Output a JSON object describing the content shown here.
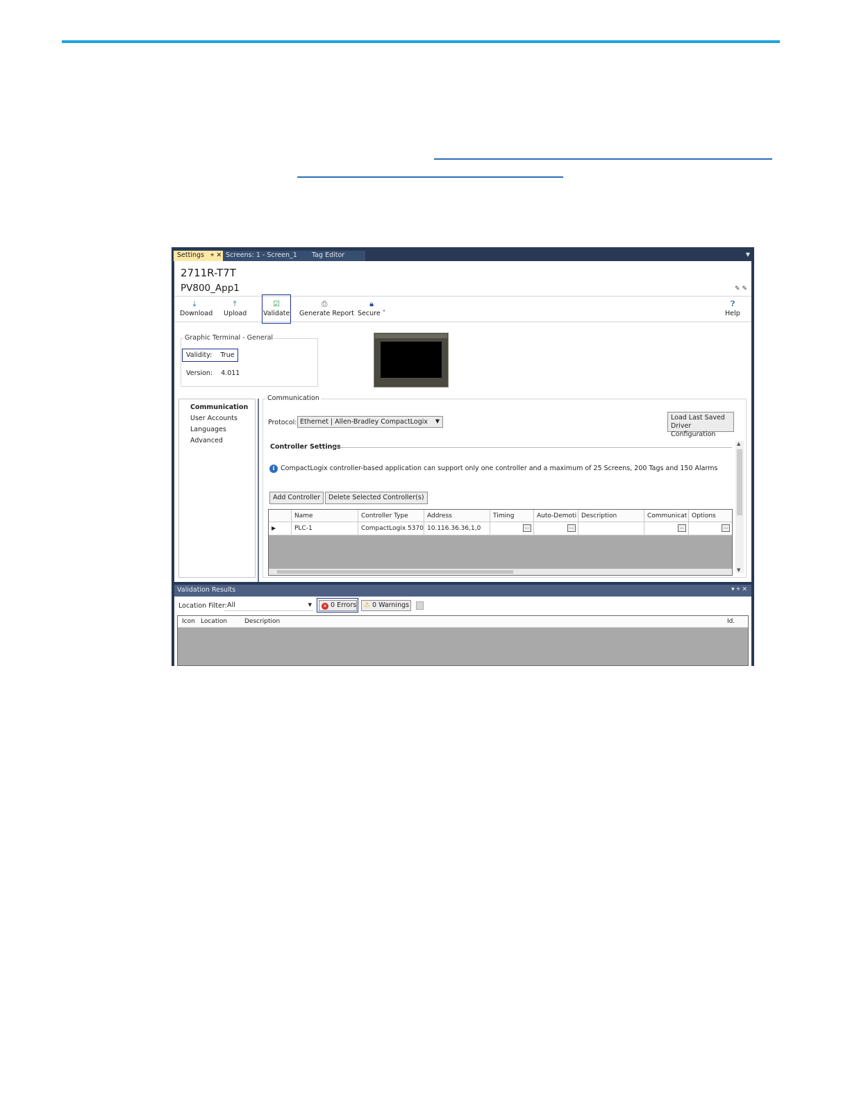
{
  "colors": {
    "accent_rule": "#1fa3dd",
    "link": "#2a6ebb",
    "ide_frame": "#293955",
    "active_tab": "#ffe8a6",
    "highlight_box": "#1d2f8c",
    "grid_empty": "#a9a9a9"
  },
  "tabs": [
    {
      "label": "Settings",
      "icons": "⌖ ✕"
    },
    {
      "label": "Screens: 1 - Screen_1"
    },
    {
      "label": "Tag Editor"
    }
  ],
  "header": {
    "device": "2711R-T7T",
    "app_name": "PV800_App1"
  },
  "toolbar": {
    "download": "Download",
    "upload": "Upload",
    "validate": "Validate",
    "generate_report": "Generate Report",
    "secure": "Secure ˅",
    "help": "Help"
  },
  "general": {
    "title": "Graphic Terminal - General",
    "validity_label": "Validity:",
    "validity_value": "True",
    "version_label": "Version:",
    "version_value": "4.011"
  },
  "nav": [
    "Communication",
    "User Accounts",
    "Languages",
    "Advanced"
  ],
  "communication": {
    "title": "Communication",
    "protocol_label": "Protocol:",
    "protocol_value": "Ethernet | Allen-Bradley CompactLogix",
    "load_line1": "Load Last Saved",
    "load_line2": "Driver Configuration",
    "controller_settings": "Controller Settings",
    "info": "CompactLogix controller-based application can support only one controller and a maximum of 25 Screens, 200 Tags and 150 Alarms",
    "add_controller": "Add Controller",
    "delete_controller": "Delete Selected Controller(s)"
  },
  "grid": {
    "columns": [
      "Name",
      "Controller Type",
      "Address",
      "Timing",
      "Auto-Demoti",
      "Description",
      "Communicat",
      "Options"
    ],
    "rows": [
      {
        "name": "PLC-1",
        "type": "CompactLogix 5370",
        "address": "10.116.36.36,1,0",
        "ellipsis": "..."
      }
    ]
  },
  "validation": {
    "title": "Validation Results",
    "controls": "▾ ⌖ ✕",
    "location_label": "Location Filter:",
    "location_value": "All",
    "errors": "0 Errors",
    "warnings": "0 Warnings",
    "columns": [
      "Icon",
      "Location",
      "Description",
      "Id."
    ]
  }
}
